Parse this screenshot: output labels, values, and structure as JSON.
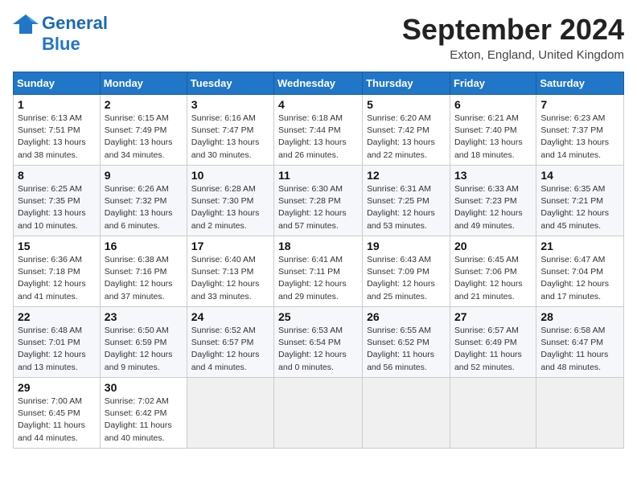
{
  "header": {
    "logo_line1": "General",
    "logo_line2": "Blue",
    "month_title": "September 2024",
    "location": "Exton, England, United Kingdom"
  },
  "weekdays": [
    "Sunday",
    "Monday",
    "Tuesday",
    "Wednesday",
    "Thursday",
    "Friday",
    "Saturday"
  ],
  "weeks": [
    [
      {
        "day": "1",
        "info": "Sunrise: 6:13 AM\nSunset: 7:51 PM\nDaylight: 13 hours\nand 38 minutes."
      },
      {
        "day": "2",
        "info": "Sunrise: 6:15 AM\nSunset: 7:49 PM\nDaylight: 13 hours\nand 34 minutes."
      },
      {
        "day": "3",
        "info": "Sunrise: 6:16 AM\nSunset: 7:47 PM\nDaylight: 13 hours\nand 30 minutes."
      },
      {
        "day": "4",
        "info": "Sunrise: 6:18 AM\nSunset: 7:44 PM\nDaylight: 13 hours\nand 26 minutes."
      },
      {
        "day": "5",
        "info": "Sunrise: 6:20 AM\nSunset: 7:42 PM\nDaylight: 13 hours\nand 22 minutes."
      },
      {
        "day": "6",
        "info": "Sunrise: 6:21 AM\nSunset: 7:40 PM\nDaylight: 13 hours\nand 18 minutes."
      },
      {
        "day": "7",
        "info": "Sunrise: 6:23 AM\nSunset: 7:37 PM\nDaylight: 13 hours\nand 14 minutes."
      }
    ],
    [
      {
        "day": "8",
        "info": "Sunrise: 6:25 AM\nSunset: 7:35 PM\nDaylight: 13 hours\nand 10 minutes."
      },
      {
        "day": "9",
        "info": "Sunrise: 6:26 AM\nSunset: 7:32 PM\nDaylight: 13 hours\nand 6 minutes."
      },
      {
        "day": "10",
        "info": "Sunrise: 6:28 AM\nSunset: 7:30 PM\nDaylight: 13 hours\nand 2 minutes."
      },
      {
        "day": "11",
        "info": "Sunrise: 6:30 AM\nSunset: 7:28 PM\nDaylight: 12 hours\nand 57 minutes."
      },
      {
        "day": "12",
        "info": "Sunrise: 6:31 AM\nSunset: 7:25 PM\nDaylight: 12 hours\nand 53 minutes."
      },
      {
        "day": "13",
        "info": "Sunrise: 6:33 AM\nSunset: 7:23 PM\nDaylight: 12 hours\nand 49 minutes."
      },
      {
        "day": "14",
        "info": "Sunrise: 6:35 AM\nSunset: 7:21 PM\nDaylight: 12 hours\nand 45 minutes."
      }
    ],
    [
      {
        "day": "15",
        "info": "Sunrise: 6:36 AM\nSunset: 7:18 PM\nDaylight: 12 hours\nand 41 minutes."
      },
      {
        "day": "16",
        "info": "Sunrise: 6:38 AM\nSunset: 7:16 PM\nDaylight: 12 hours\nand 37 minutes."
      },
      {
        "day": "17",
        "info": "Sunrise: 6:40 AM\nSunset: 7:13 PM\nDaylight: 12 hours\nand 33 minutes."
      },
      {
        "day": "18",
        "info": "Sunrise: 6:41 AM\nSunset: 7:11 PM\nDaylight: 12 hours\nand 29 minutes."
      },
      {
        "day": "19",
        "info": "Sunrise: 6:43 AM\nSunset: 7:09 PM\nDaylight: 12 hours\nand 25 minutes."
      },
      {
        "day": "20",
        "info": "Sunrise: 6:45 AM\nSunset: 7:06 PM\nDaylight: 12 hours\nand 21 minutes."
      },
      {
        "day": "21",
        "info": "Sunrise: 6:47 AM\nSunset: 7:04 PM\nDaylight: 12 hours\nand 17 minutes."
      }
    ],
    [
      {
        "day": "22",
        "info": "Sunrise: 6:48 AM\nSunset: 7:01 PM\nDaylight: 12 hours\nand 13 minutes."
      },
      {
        "day": "23",
        "info": "Sunrise: 6:50 AM\nSunset: 6:59 PM\nDaylight: 12 hours\nand 9 minutes."
      },
      {
        "day": "24",
        "info": "Sunrise: 6:52 AM\nSunset: 6:57 PM\nDaylight: 12 hours\nand 4 minutes."
      },
      {
        "day": "25",
        "info": "Sunrise: 6:53 AM\nSunset: 6:54 PM\nDaylight: 12 hours\nand 0 minutes."
      },
      {
        "day": "26",
        "info": "Sunrise: 6:55 AM\nSunset: 6:52 PM\nDaylight: 11 hours\nand 56 minutes."
      },
      {
        "day": "27",
        "info": "Sunrise: 6:57 AM\nSunset: 6:49 PM\nDaylight: 11 hours\nand 52 minutes."
      },
      {
        "day": "28",
        "info": "Sunrise: 6:58 AM\nSunset: 6:47 PM\nDaylight: 11 hours\nand 48 minutes."
      }
    ],
    [
      {
        "day": "29",
        "info": "Sunrise: 7:00 AM\nSunset: 6:45 PM\nDaylight: 11 hours\nand 44 minutes."
      },
      {
        "day": "30",
        "info": "Sunrise: 7:02 AM\nSunset: 6:42 PM\nDaylight: 11 hours\nand 40 minutes."
      },
      null,
      null,
      null,
      null,
      null
    ]
  ]
}
